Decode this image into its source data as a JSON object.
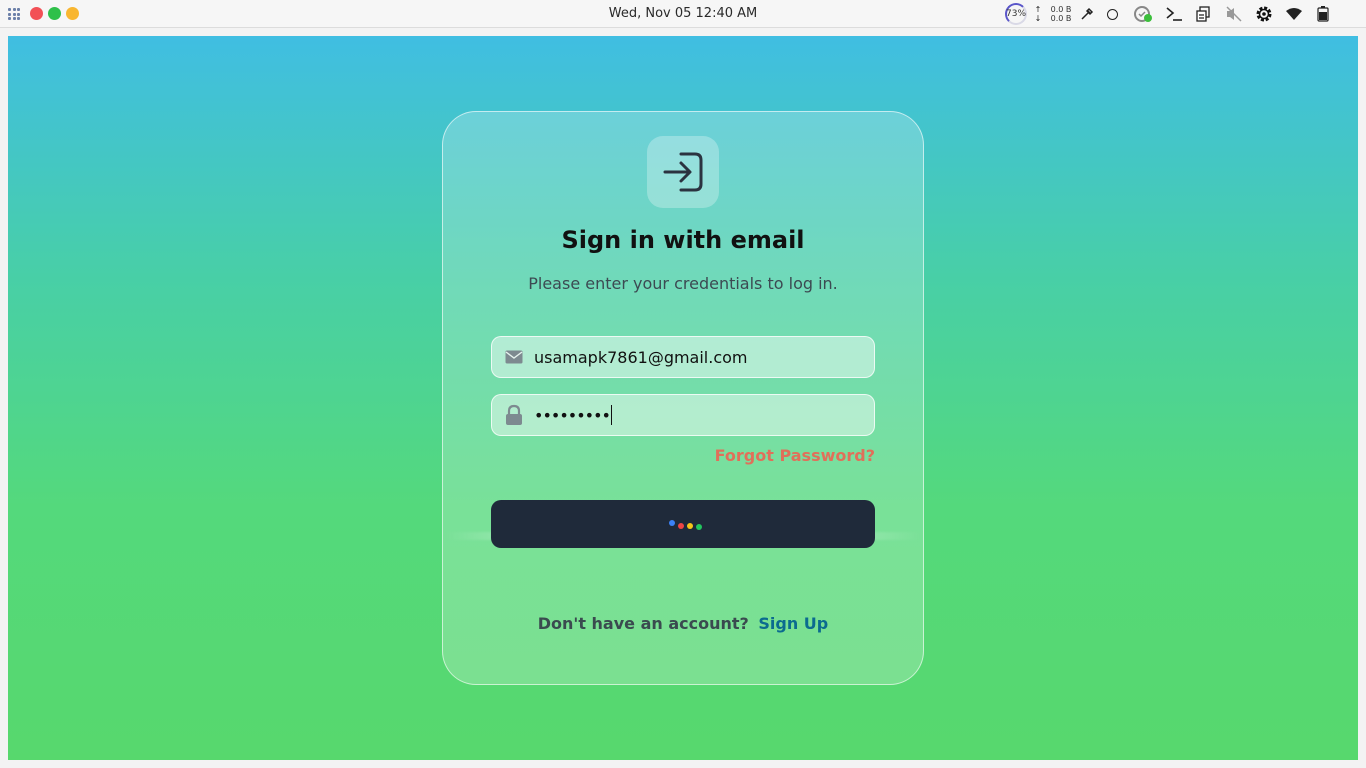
{
  "system_bar": {
    "clock": "Wed, Nov 05 12:40 AM",
    "cpu_percent": "73%",
    "net_up": "0.0 B",
    "net_down": "0.0 B",
    "net_up_arrow": "↑",
    "net_down_arrow": "↓",
    "icons": [
      "apps-grid-icon",
      "color-picker-icon",
      "circle-icon",
      "update-icon",
      "terminal-icon",
      "clipboard-icon",
      "volume-muted-icon",
      "settings-gear-icon",
      "wifi-icon",
      "battery-icon"
    ]
  },
  "window_controls": {
    "close_color": "#f25056",
    "maximize_color": "#2fc04a",
    "minimize_color": "#f8b630"
  },
  "login": {
    "title": "Sign in with email",
    "subtitle": "Please enter your credentials to log in.",
    "email": {
      "value": "usamapk7861@gmail.com",
      "icon": "mail-icon"
    },
    "password": {
      "masked_value": "•••••••••",
      "icon": "lock-icon"
    },
    "forgot_password": "Forgot Password?",
    "submit_state": "loading",
    "loading_dot_colors": [
      "#3b82f6",
      "#ef4444",
      "#f5c518",
      "#22c55e"
    ],
    "signup_prompt": "Don't have an account?",
    "signup_link": "Sign Up"
  },
  "colors": {
    "gradient_top": "#40bee2",
    "gradient_bottom": "#57d86d",
    "button_bg": "#1f2a3a",
    "forgot_color": "#e0705a",
    "signup_link_color": "#0b6b8f"
  }
}
